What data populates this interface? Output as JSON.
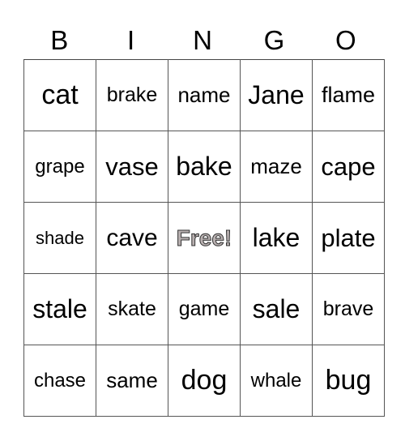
{
  "header": [
    "B",
    "I",
    "N",
    "G",
    "O"
  ],
  "rows": [
    [
      {
        "t": "cat",
        "s": 34
      },
      {
        "t": "brake",
        "s": 25
      },
      {
        "t": "name",
        "s": 26
      },
      {
        "t": "Jane",
        "s": 32
      },
      {
        "t": "flame",
        "s": 27
      }
    ],
    [
      {
        "t": "grape",
        "s": 24
      },
      {
        "t": "vase",
        "s": 31
      },
      {
        "t": "bake",
        "s": 32
      },
      {
        "t": "maze",
        "s": 26
      },
      {
        "t": "cape",
        "s": 31
      }
    ],
    [
      {
        "t": "shade",
        "s": 22
      },
      {
        "t": "cave",
        "s": 30
      },
      {
        "t": "Free!",
        "free": true
      },
      {
        "t": "lake",
        "s": 32
      },
      {
        "t": "plate",
        "s": 31
      }
    ],
    [
      {
        "t": "stale",
        "s": 32
      },
      {
        "t": "skate",
        "s": 25
      },
      {
        "t": "game",
        "s": 25
      },
      {
        "t": "sale",
        "s": 32
      },
      {
        "t": "brave",
        "s": 25
      }
    ],
    [
      {
        "t": "chase",
        "s": 24
      },
      {
        "t": "same",
        "s": 26
      },
      {
        "t": "dog",
        "s": 34
      },
      {
        "t": "whale",
        "s": 24
      },
      {
        "t": "bug",
        "s": 34
      }
    ]
  ]
}
